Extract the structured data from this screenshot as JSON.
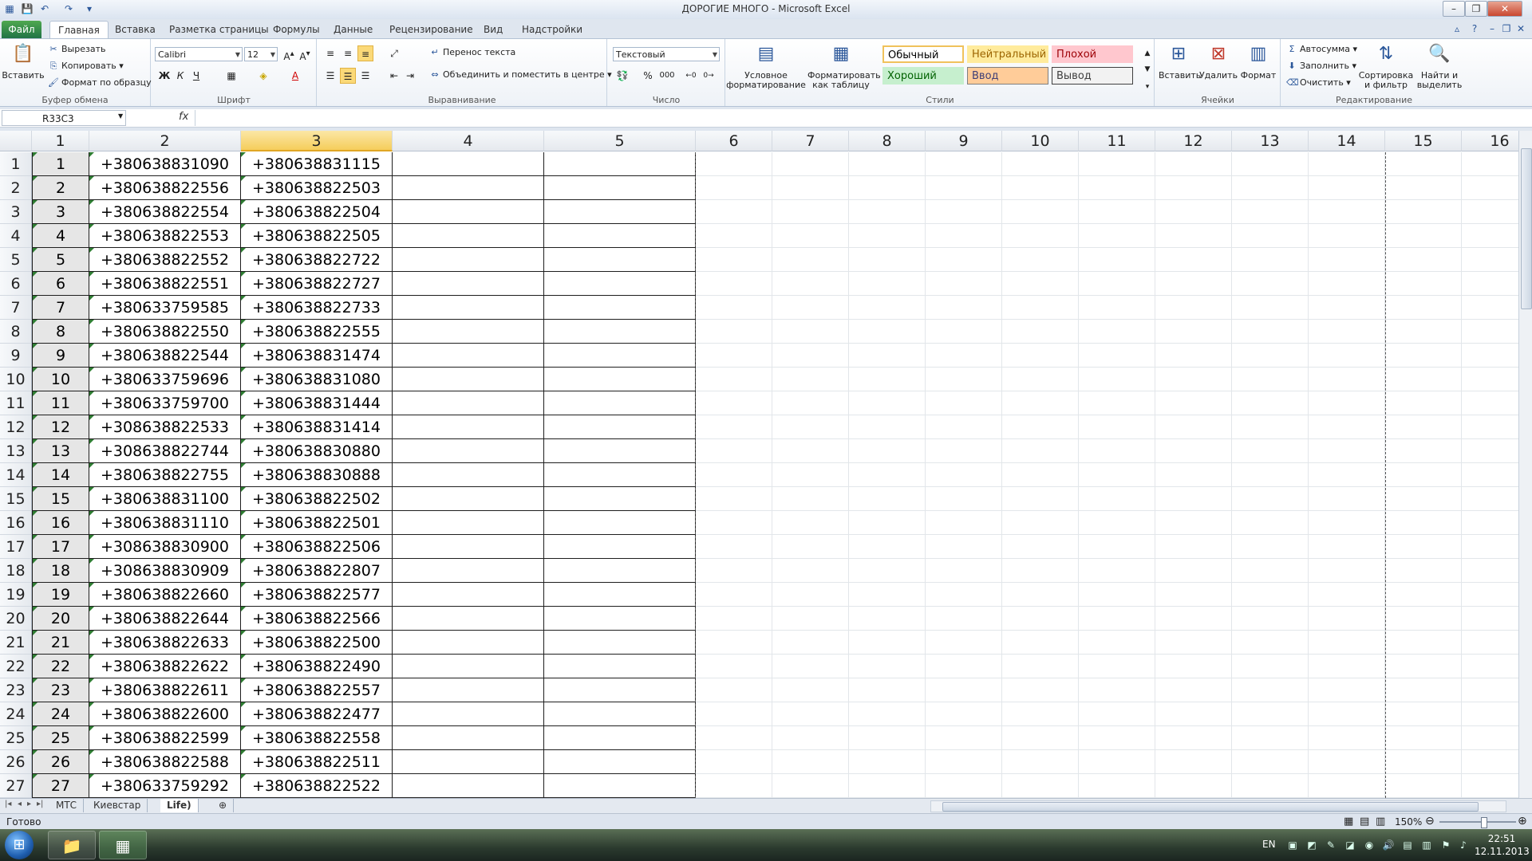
{
  "window": {
    "title": "ДОРОГИЕ МНОГО  -  Microsoft Excel"
  },
  "tabs": [
    "Файл",
    "Главная",
    "Вставка",
    "Разметка страницы",
    "Формулы",
    "Данные",
    "Рецензирование",
    "Вид",
    "Надстройки"
  ],
  "active_tab": "Главная",
  "ribbon": {
    "clipboard": {
      "label": "Буфер обмена",
      "paste": "Вставить",
      "cut": "Вырезать",
      "copy": "Копировать",
      "format_painter": "Формат по образцу"
    },
    "font": {
      "label": "Шрифт",
      "name": "Calibri",
      "size": "12",
      "bold": "Ж",
      "italic": "К",
      "underline": "Ч"
    },
    "alignment": {
      "label": "Выравнивание",
      "wrap": "Перенос текста",
      "merge": "Объединить и поместить в центре"
    },
    "number": {
      "label": "Число",
      "format": "Текстовый",
      "percent": "%",
      "thousands": "000"
    },
    "styles": {
      "label": "Стили",
      "conditional": "Условное форматирование",
      "as_table": "Форматировать как таблицу",
      "cells": [
        {
          "name": "Обычный",
          "bg": "#ffffff",
          "fg": "#000000",
          "border": "#f0c25b"
        },
        {
          "name": "Нейтральный",
          "bg": "#ffeb9c",
          "fg": "#9c6500",
          "border": "#ffeb9c"
        },
        {
          "name": "Плохой",
          "bg": "#ffc7ce",
          "fg": "#9c0006",
          "border": "#ffc7ce"
        },
        {
          "name": "Хороший",
          "bg": "#c6efce",
          "fg": "#006100",
          "border": "#c6efce"
        },
        {
          "name": "Ввод",
          "bg": "#ffcc99",
          "fg": "#3f3f76",
          "border": "#7f7f7f"
        },
        {
          "name": "Вывод",
          "bg": "#f2f2f2",
          "fg": "#3f3f3f",
          "border": "#3f3f3f"
        }
      ]
    },
    "cells_group": {
      "label": "Ячейки",
      "insert": "Вставить",
      "delete": "Удалить",
      "format": "Формат"
    },
    "editing": {
      "label": "Редактирование",
      "autosum": "Автосумма",
      "fill": "Заполнить",
      "clear": "Очистить",
      "sort": "Сортировка и фильтр",
      "find": "Найти и выделить"
    }
  },
  "formula_bar": {
    "name_box": "R33C3",
    "fx": "fx",
    "formula": ""
  },
  "grid": {
    "column_headers": [
      "1",
      "2",
      "3",
      "4",
      "5",
      "6",
      "7",
      "8",
      "9",
      "10",
      "11",
      "12",
      "13",
      "14",
      "15",
      "16"
    ],
    "selected_column": "3",
    "row_headers": [
      "1",
      "2",
      "3",
      "4",
      "5",
      "6",
      "7",
      "8",
      "9",
      "10",
      "11",
      "12",
      "13",
      "14",
      "15",
      "16",
      "17",
      "18",
      "19",
      "20",
      "21",
      "22",
      "23",
      "24",
      "25",
      "26",
      "27"
    ],
    "rows": [
      [
        "1",
        "+380638831090",
        "+380638831115"
      ],
      [
        "2",
        "+380638822556",
        "+380638822503"
      ],
      [
        "3",
        "+380638822554",
        "+380638822504"
      ],
      [
        "4",
        "+380638822553",
        "+380638822505"
      ],
      [
        "5",
        "+380638822552",
        "+380638822722"
      ],
      [
        "6",
        "+380638822551",
        "+380638822727"
      ],
      [
        "7",
        "+380633759585",
        "+380638822733"
      ],
      [
        "8",
        "+380638822550",
        "+380638822555"
      ],
      [
        "9",
        "+380638822544",
        "+380638831474"
      ],
      [
        "10",
        "+380633759696",
        "+380638831080"
      ],
      [
        "11",
        "+380633759700",
        "+380638831444"
      ],
      [
        "12",
        "+308638822533",
        "+380638831414"
      ],
      [
        "13",
        "+308638822744",
        "+380638830880"
      ],
      [
        "14",
        "+380638822755",
        "+380638830888"
      ],
      [
        "15",
        "+380638831100",
        "+380638822502"
      ],
      [
        "16",
        "+380638831110",
        "+380638822501"
      ],
      [
        "17",
        "+308638830900",
        "+380638822506"
      ],
      [
        "18",
        "+308638830909",
        "+380638822807"
      ],
      [
        "19",
        "+380638822660",
        "+380638822577"
      ],
      [
        "20",
        "+380638822644",
        "+380638822566"
      ],
      [
        "21",
        "+380638822633",
        "+380638822500"
      ],
      [
        "22",
        "+380638822622",
        "+380638822490"
      ],
      [
        "23",
        "+380638822611",
        "+380638822557"
      ],
      [
        "24",
        "+380638822600",
        "+380638822477"
      ],
      [
        "25",
        "+380638822599",
        "+380638822558"
      ],
      [
        "26",
        "+380638822588",
        "+380638822511"
      ],
      [
        "27",
        "+380633759292",
        "+380638822522"
      ]
    ]
  },
  "sheets": [
    "МТС",
    "Киевстар",
    "Life)"
  ],
  "active_sheet": "Life)",
  "status": {
    "ready": "Готово",
    "zoom": "150%"
  },
  "taskbar": {
    "lang": "EN",
    "time": "22:51",
    "date": "12.11.2013"
  }
}
